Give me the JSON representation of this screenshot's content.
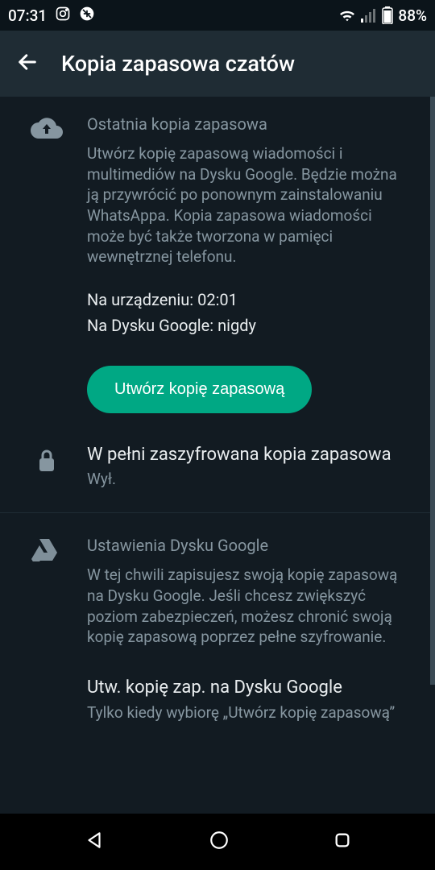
{
  "statusbar": {
    "time": "07:31",
    "battery": "88%"
  },
  "appbar": {
    "title": "Kopia zapasowa czatów"
  },
  "lastBackup": {
    "title": "Ostatnia kopia zapasowa",
    "desc": "Utwórz kopię zapasową wiadomości i multimediów na Dysku Google. Będzie można ją przywrócić po ponownym zainstalowaniu WhatsAppa. Kopia zapasowa wiadomości może być także tworzona w pamięci wewnętrznej telefonu.",
    "localLine": "Na urządzeniu: 02:01",
    "googleLine": "Na Dysku Google: nigdy",
    "button": "Utwórz kopię zapasową"
  },
  "encrypted": {
    "title": "W pełni zaszyfrowana kopia zapasowa",
    "sub": "Wył."
  },
  "gdrive": {
    "title": "Ustawienia Dysku Google",
    "desc": "W tej chwili zapisujesz swoją kopię zapasową na Dysku Google. Jeśli chcesz zwiększyć poziom zabezpieczeń, możesz chronić swoją kopię zapasową poprzez pełne szyfrowanie.",
    "freqTitle": "Utw. kopię zap. na Dysku Google",
    "freqSub": "Tylko kiedy wybiorę „Utwórz kopię zapasową”"
  }
}
